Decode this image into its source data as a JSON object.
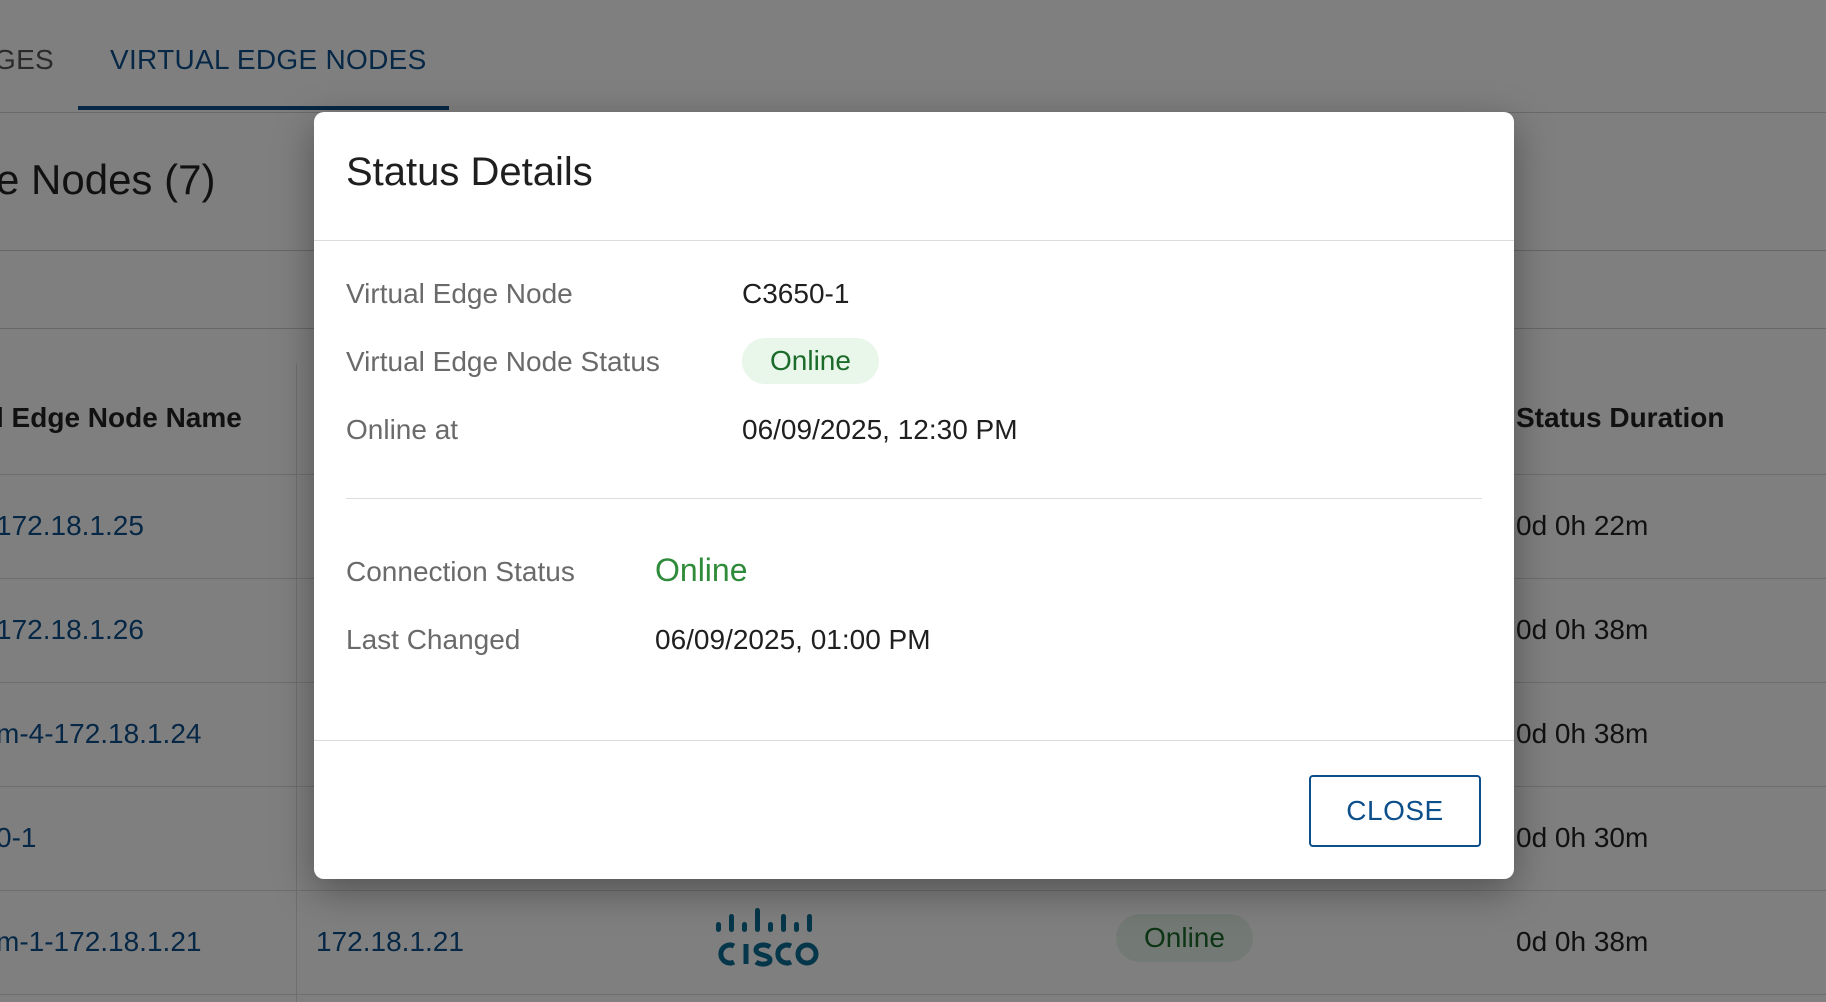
{
  "tabs": {
    "previous_label": "GES",
    "active_label": "VIRTUAL EDGE NODES"
  },
  "section_title": "e Nodes (7)",
  "table": {
    "headers": {
      "name": "l Edge Node Name",
      "status_duration": "Status Duration"
    },
    "rows": [
      {
        "name": "172.18.1.25",
        "duration": "0d 0h 22m"
      },
      {
        "name": "172.18.1.26",
        "duration": "0d 0h 38m"
      },
      {
        "name": "m-4-172.18.1.24",
        "duration": "0d 0h 38m"
      },
      {
        "name": "0-1",
        "duration": "0d 0h 30m"
      },
      {
        "name": "m-1-172.18.1.21",
        "ip": "172.18.1.21",
        "vendor_logo": "cisco",
        "status": "Online",
        "duration": "0d 0h 38m"
      }
    ]
  },
  "dialog": {
    "title": "Status Details",
    "fields": {
      "vedge_node_label": "Virtual Edge Node",
      "vedge_node_value": "C3650-1",
      "vedge_status_label": "Virtual Edge Node Status",
      "vedge_status_value": "Online",
      "online_at_label": "Online at",
      "online_at_value": "06/09/2025, 12:30 PM",
      "connection_status_label": "Connection Status",
      "connection_status_value": "Online",
      "last_changed_label": "Last Changed",
      "last_changed_value": "06/09/2025, 01:00 PM"
    },
    "close_label": "CLOSE"
  },
  "colors": {
    "primary": "#0d4f8b",
    "status_green": "#2e8b3a",
    "pill_bg": "#e9f6ea"
  }
}
